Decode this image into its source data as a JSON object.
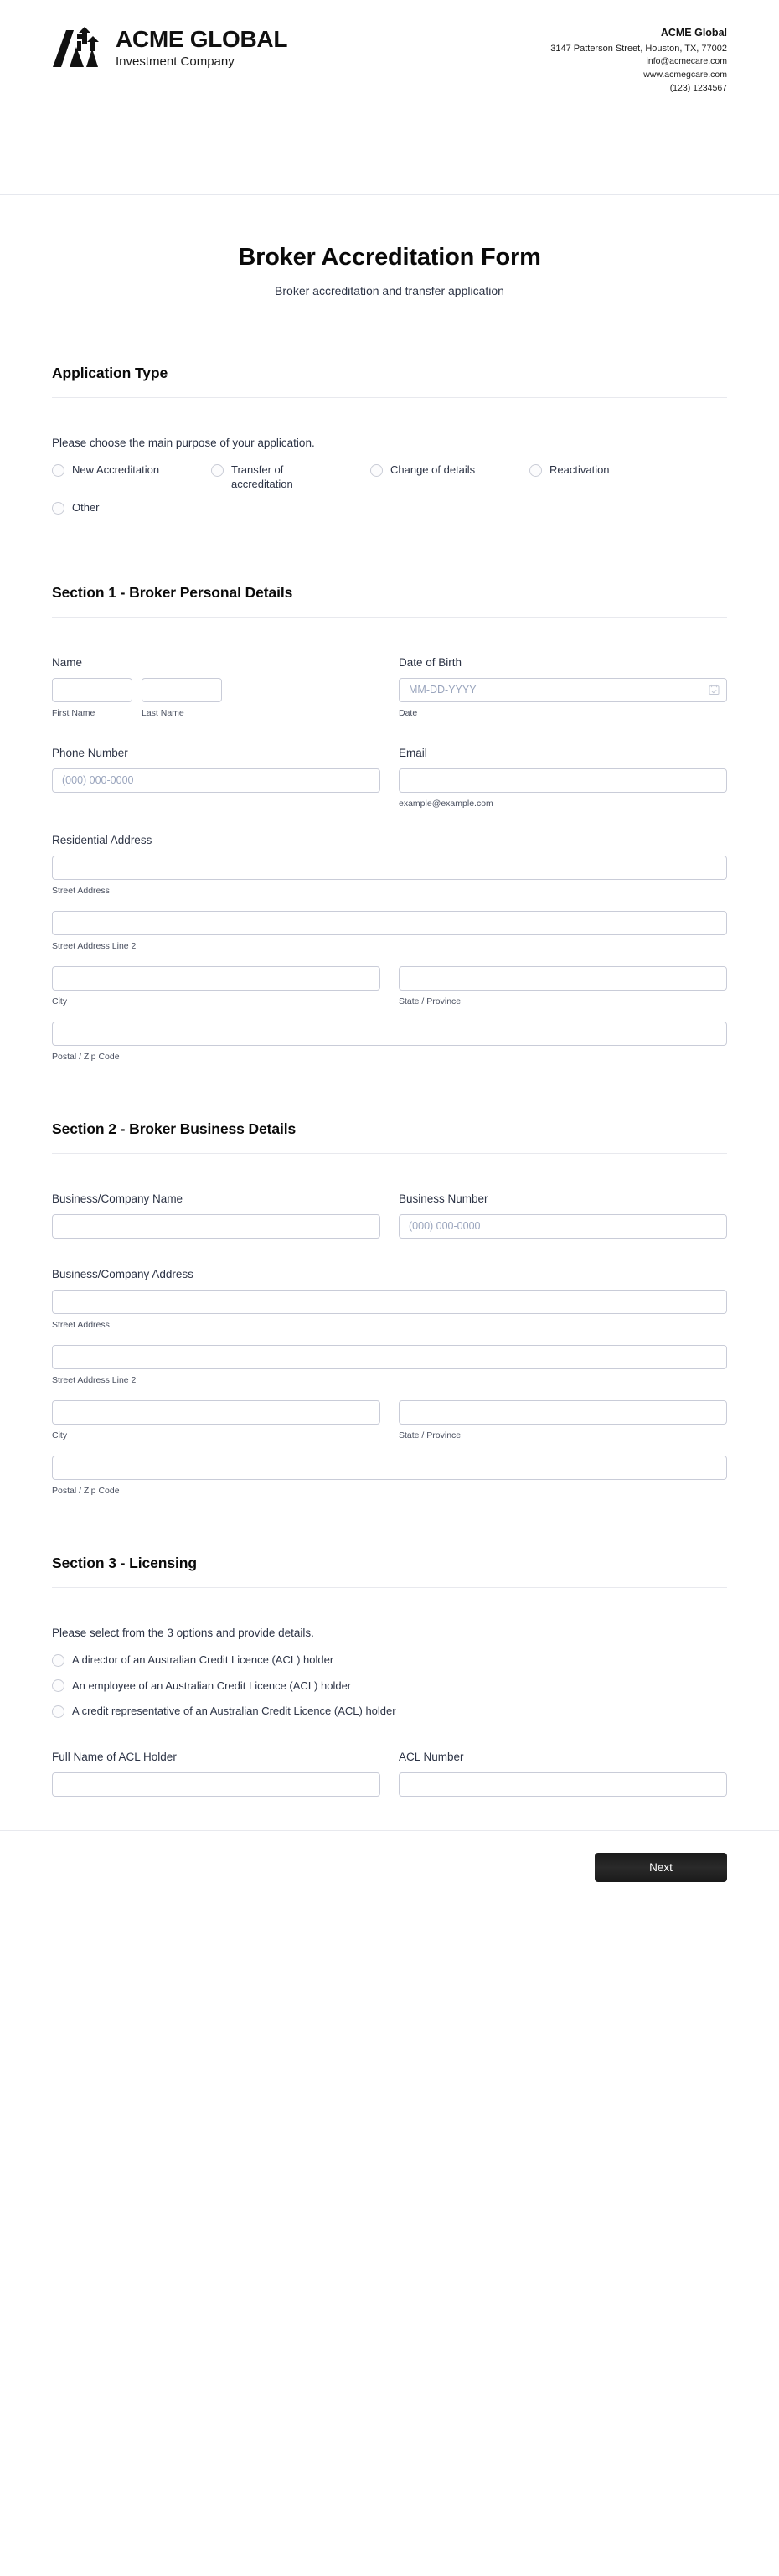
{
  "header": {
    "brand_name": "ACME GLOBAL",
    "brand_sub": "Investment Company",
    "logo_icon": "mountain-arrows-logo",
    "contact": {
      "name": "ACME Global",
      "address": "3147 Patterson Street, Houston, TX, 77002",
      "email": "info@acmecare.com",
      "website": "www.acmegcare.com",
      "phone": "(123) 1234567"
    }
  },
  "form": {
    "title": "Broker Accreditation Form",
    "subtitle": "Broker accreditation and transfer application"
  },
  "application_type": {
    "heading": "Application Type",
    "help": "Please choose the main purpose of your application.",
    "options": [
      "New Accreditation",
      "Transfer of accreditation",
      "Change of details",
      "Reactivation",
      "Other"
    ]
  },
  "section1": {
    "heading": "Section 1 - Broker Personal Details",
    "name": {
      "label": "Name",
      "first_sub": "First Name",
      "last_sub": "Last Name",
      "first_value": "",
      "last_value": ""
    },
    "dob": {
      "label": "Date of Birth",
      "placeholder": "MM-DD-YYYY",
      "sub": "Date",
      "value": "",
      "icon": "calendar-check-icon"
    },
    "phone": {
      "label": "Phone Number",
      "placeholder": "(000) 000-0000",
      "value": ""
    },
    "email": {
      "label": "Email",
      "sub": "example@example.com",
      "placeholder": "",
      "value": ""
    },
    "address": {
      "label": "Residential Address",
      "street_sub": "Street Address",
      "street2_sub": "Street Address Line 2",
      "city_sub": "City",
      "state_sub": "State / Province",
      "postal_sub": "Postal / Zip Code",
      "street_value": "",
      "street2_value": "",
      "city_value": "",
      "state_value": "",
      "postal_value": ""
    }
  },
  "section2": {
    "heading": "Section 2 - Broker Business Details",
    "company_name": {
      "label": "Business/Company Name",
      "value": ""
    },
    "business_number": {
      "label": "Business Number",
      "placeholder": "(000) 000-0000",
      "value": ""
    },
    "address": {
      "label": "Business/Company Address",
      "street_sub": "Street Address",
      "street2_sub": "Street Address Line 2",
      "city_sub": "City",
      "state_sub": "State / Province",
      "postal_sub": "Postal / Zip Code",
      "street_value": "",
      "street2_value": "",
      "city_value": "",
      "state_value": "",
      "postal_value": ""
    }
  },
  "section3": {
    "heading": "Section 3 - Licensing",
    "help": "Please select from the 3 options and provide details.",
    "options": [
      "A director of an Australian Credit Licence (ACL) holder",
      "An employee of an Australian Credit Licence (ACL) holder",
      "A credit representative of an Australian Credit Licence (ACL) holder"
    ],
    "acl_holder": {
      "label": "Full Name of ACL Holder",
      "value": ""
    },
    "acl_number": {
      "label": "ACL Number",
      "value": ""
    }
  },
  "footer": {
    "next_label": "Next"
  },
  "colors": {
    "page_bg": "#ffffff",
    "text": "#2c3345",
    "heading": "#0a0a0a",
    "border": "#c9ccd8",
    "divider": "#e8e9ee",
    "placeholder": "#9aa5bd",
    "button_bg": "#222222"
  }
}
